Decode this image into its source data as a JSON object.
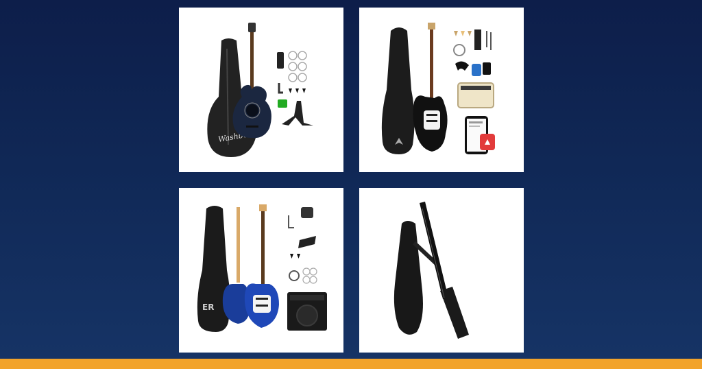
{
  "colors": {
    "background_top": "#0d1e4a",
    "background_bottom": "#163466",
    "accent_bar": "#f2a32b",
    "tile_background": "#ffffff"
  },
  "products": [
    {
      "brand_mark": "Washburn",
      "kind": "acoustic guitar kit"
    },
    {
      "brand_mark": "",
      "kind": "electric guitar kit with amp"
    },
    {
      "brand_mark": "ER",
      "kind": "electric guitar kit blue"
    },
    {
      "brand_mark": "",
      "kind": "headless travel guitar"
    }
  ]
}
